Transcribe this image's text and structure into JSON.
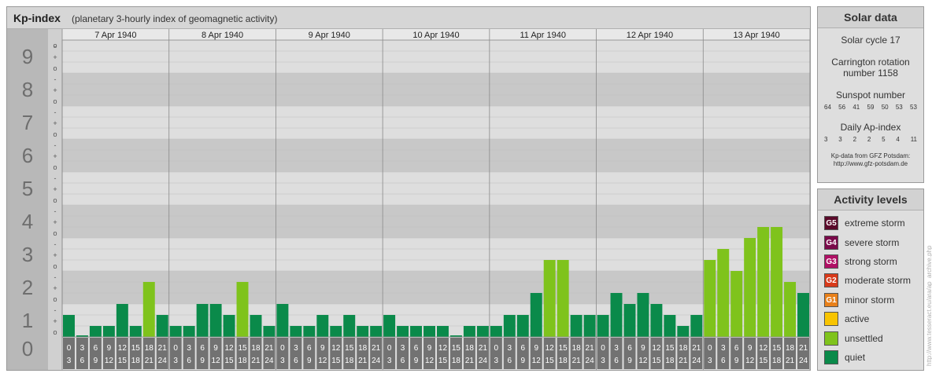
{
  "header": {
    "title": "Kp-index",
    "subtitle": "(planetary 3-hourly index of geomagnetic activity)"
  },
  "chart_data": {
    "type": "bar",
    "title": "Kp-index",
    "subtitle": "(planetary 3-hourly index of geomagnetic activity)",
    "ylim": [
      0,
      9
    ],
    "y_ticks": [
      "0",
      "1",
      "2",
      "3",
      "4",
      "5",
      "6",
      "7",
      "8",
      "9"
    ],
    "sub_ticks": [
      "-",
      "o",
      "+"
    ],
    "days": [
      "7 Apr 1940",
      "8 Apr 1940",
      "9 Apr 1940",
      "10 Apr 1940",
      "11 Apr 1940",
      "12 Apr 1940",
      "13 Apr 1940"
    ],
    "intervals": [
      [
        "0",
        "3"
      ],
      [
        "3",
        "6"
      ],
      [
        "6",
        "9"
      ],
      [
        "9",
        "12"
      ],
      [
        "12",
        "15"
      ],
      [
        "15",
        "18"
      ],
      [
        "18",
        "21"
      ],
      [
        "21",
        "24"
      ]
    ],
    "values": [
      [
        0.667,
        0.0,
        0.333,
        0.333,
        1.0,
        0.333,
        1.667,
        0.667
      ],
      [
        0.333,
        0.333,
        1.0,
        1.0,
        0.667,
        1.667,
        0.667,
        0.333
      ],
      [
        1.0,
        0.333,
        0.333,
        0.667,
        0.333,
        0.667,
        0.333,
        0.333
      ],
      [
        0.667,
        0.333,
        0.333,
        0.333,
        0.333,
        0.0,
        0.333,
        0.333
      ],
      [
        0.333,
        0.667,
        0.667,
        1.333,
        2.333,
        2.333,
        0.667,
        0.667
      ],
      [
        0.667,
        1.333,
        1.0,
        1.333,
        1.0,
        0.667,
        0.333,
        0.667
      ],
      [
        2.333,
        2.667,
        2.0,
        3.0,
        3.333,
        3.333,
        1.667,
        1.333
      ]
    ],
    "color_rule": "quiet below 2-, unsettled at 2- and above",
    "colors": {
      "quiet": "#0a8a4a",
      "unsettled": "#7fc31c",
      "band_dark": "#c8c8c8",
      "band_light": "#dedede",
      "label_col": "#b8b8b8",
      "interval_bg": "#727272",
      "number_color": "#6e6e6e"
    },
    "grid": true
  },
  "solar": {
    "title": "Solar data",
    "cycle": "Solar cycle 17",
    "rotation_line1": "Carrington rotation",
    "rotation_line2": "number 1158",
    "sunspot_title": "Sunspot number",
    "sunspot_values": [
      "64",
      "56",
      "41",
      "59",
      "50",
      "53",
      "53"
    ],
    "ap_title": "Daily Ap-index",
    "ap_values": [
      "3",
      "3",
      "2",
      "2",
      "5",
      "4",
      "11"
    ],
    "credit1": "Kp-data from GFZ Potsdam:",
    "credit2": "http://www.gfz-potsdam.de"
  },
  "activity": {
    "title": "Activity levels",
    "levels": [
      {
        "code": "G5",
        "label": "extreme storm",
        "color": "#5a0a2a"
      },
      {
        "code": "G4",
        "label": "severe storm",
        "color": "#7a0a4a"
      },
      {
        "code": "G3",
        "label": "strong storm",
        "color": "#b01065"
      },
      {
        "code": "G2",
        "label": "moderate storm",
        "color": "#d83a1a"
      },
      {
        "code": "G1",
        "label": "minor storm",
        "color": "#e8801a"
      },
      {
        "code": "",
        "label": "active",
        "color": "#f8c400"
      },
      {
        "code": "",
        "label": "unsettled",
        "color": "#7fc31c"
      },
      {
        "code": "",
        "label": "quiet",
        "color": "#0a8a4a"
      }
    ]
  },
  "watermark": "http://www.tesseract.eu/ara/ap_archive.php"
}
